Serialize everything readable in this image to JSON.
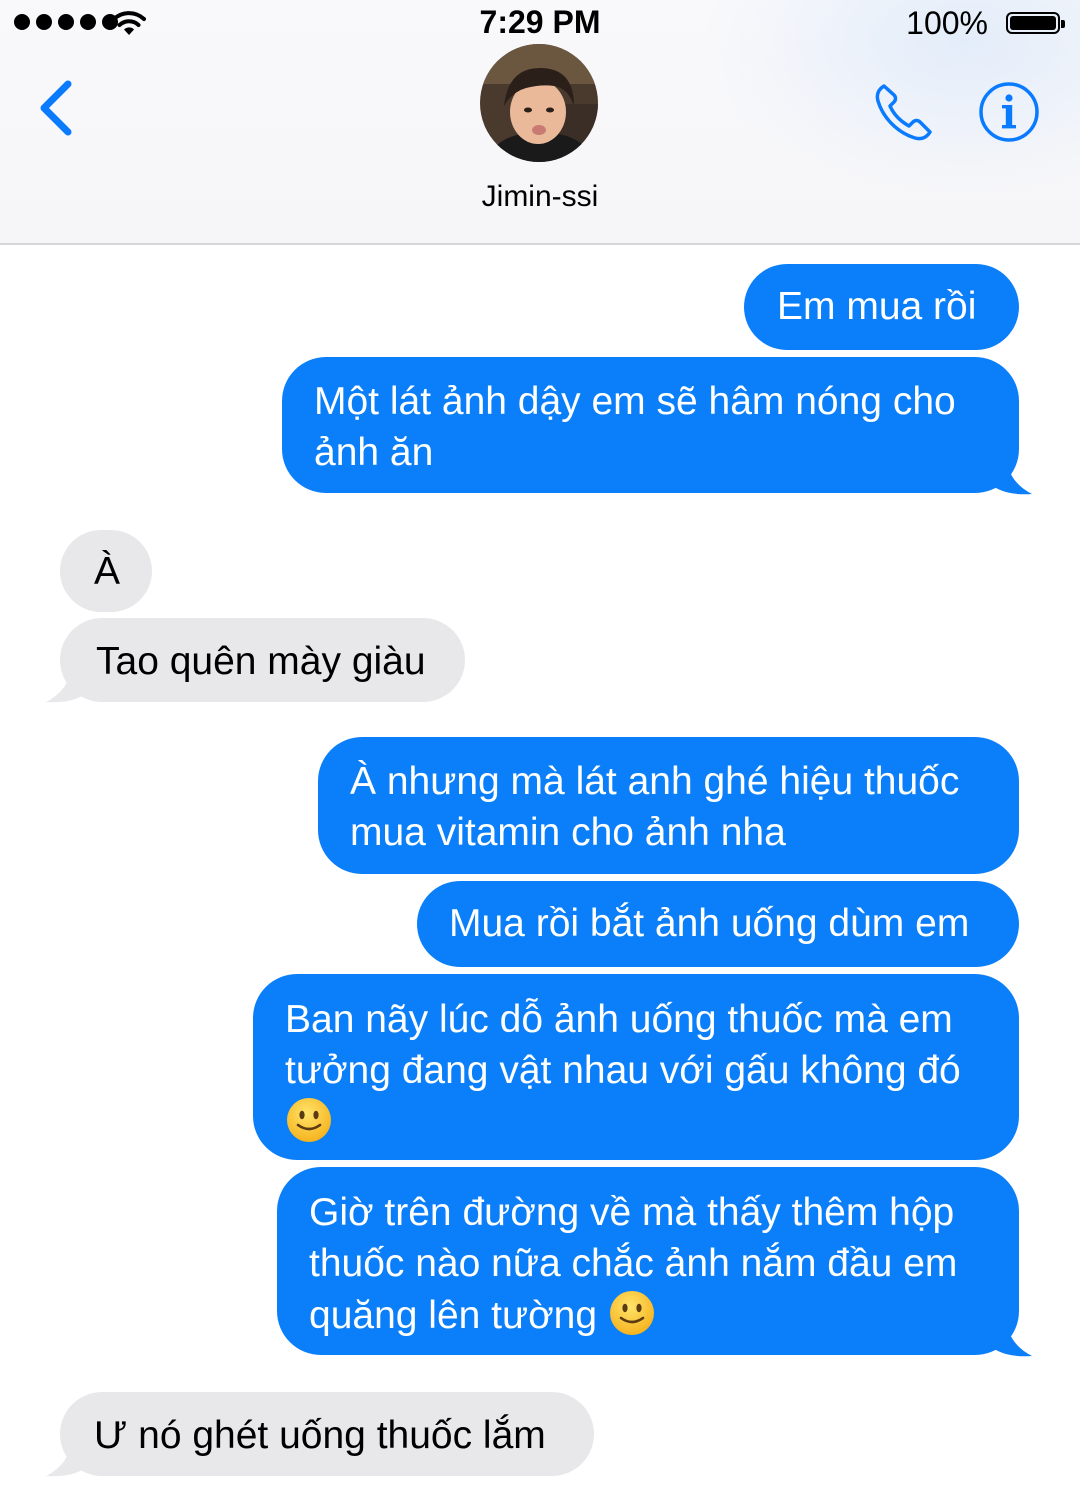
{
  "status_bar": {
    "time": "7:29 PM",
    "battery": "100%",
    "signal_icon": "signal-dots-icon",
    "wifi_icon": "wifi-icon",
    "battery_icon": "battery-icon"
  },
  "header": {
    "contact_name": "Jimin-ssi",
    "back_icon": "chevron-left-icon",
    "call_icon": "phone-icon",
    "info_icon": "info-icon",
    "avatar": "contact-avatar"
  },
  "colors": {
    "outgoing_bubble": "#0b7ff9",
    "incoming_bubble": "#e8e8eb",
    "accent": "#0a7aff"
  },
  "messages": [
    {
      "direction": "outgoing",
      "lines": [
        "Em mua rồi"
      ]
    },
    {
      "direction": "outgoing",
      "lines": [
        "Một lát ảnh dậy em sẽ hâm nóng cho",
        "ảnh ăn"
      ]
    },
    {
      "direction": "incoming",
      "lines": [
        "À"
      ]
    },
    {
      "direction": "incoming",
      "lines": [
        "Tao quên mày giàu"
      ]
    },
    {
      "direction": "outgoing",
      "lines": [
        "À nhưng mà lát anh ghé hiệu thuốc",
        "mua vitamin cho ảnh nha"
      ]
    },
    {
      "direction": "outgoing",
      "lines": [
        "Mua rồi bắt ảnh uống dùm em"
      ]
    },
    {
      "direction": "outgoing",
      "lines": [
        "Ban nãy lúc dỗ ảnh uống thuốc mà em",
        "tưởng đang vật nhau với gấu không đó",
        ""
      ],
      "emoji": "slightly-smiling-face-emoji"
    },
    {
      "direction": "outgoing",
      "lines": [
        "Giờ trên đường về mà thấy thêm hộp",
        "thuốc nào nữa chắc ảnh nắm đầu em",
        "quăng lên tường "
      ],
      "emoji": "slightly-smiling-face-emoji"
    },
    {
      "direction": "incoming",
      "lines": [
        "Ư nó ghét uống thuốc lắm"
      ]
    }
  ]
}
